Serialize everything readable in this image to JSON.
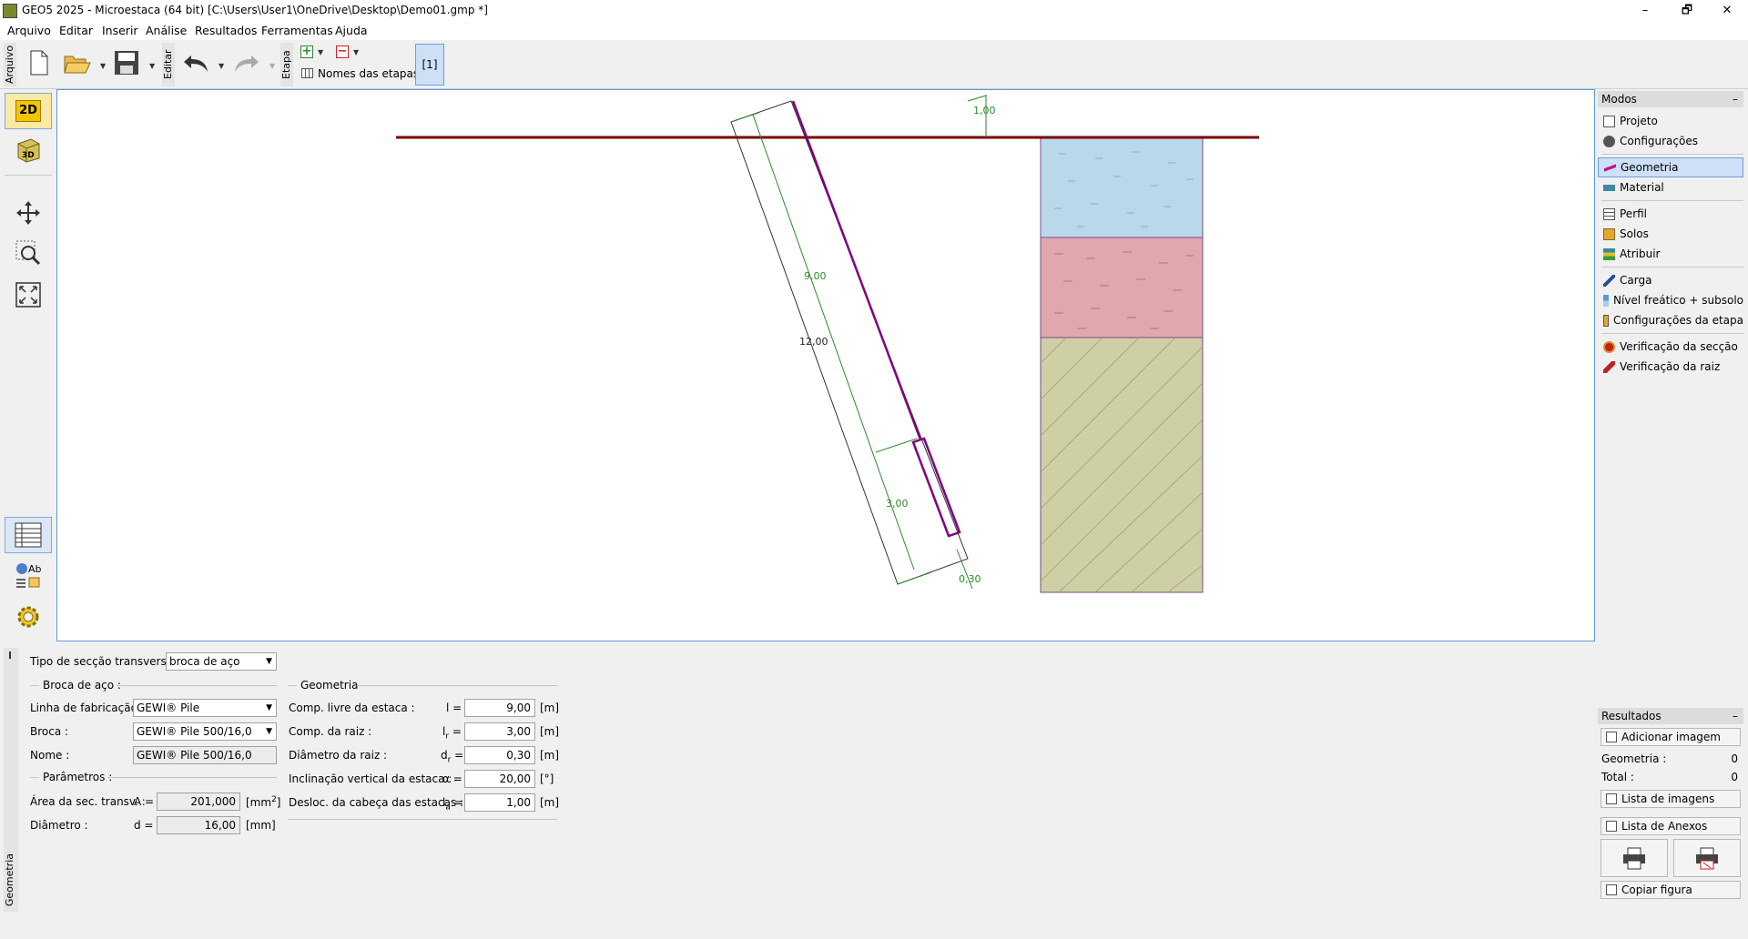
{
  "window": {
    "title": "GEO5 2025 - Microestaca (64 bit) [C:\\Users\\User1\\OneDrive\\Desktop\\Demo01.gmp *]",
    "minimize": "–",
    "maximize": "🗗",
    "close": "✕"
  },
  "menu": [
    "Arquivo",
    "Editar",
    "Inserir",
    "Análise",
    "Resultados",
    "Ferramentas",
    "Ajuda"
  ],
  "toolbar": {
    "tab_file": "Arquivo",
    "tab_edit": "Editar",
    "tab_stage": "Etapa",
    "stage_names": "Nomes das etapas",
    "stage_current": "[1]"
  },
  "leftbar": {
    "btn_2d": "2D",
    "btn_3d": "3D"
  },
  "drawing": {
    "free_length": "9,00",
    "total_length": "12,00",
    "root_length": "3,00",
    "root_diameter": "0,30",
    "head_offset": "1,00",
    "colors": {
      "ground_line": "#7a0000",
      "pile": "#800080",
      "dimension": "#2a8a2a",
      "layer1": "#b9d9ea",
      "layer2": "#e0a8ae",
      "layer3": "#cfcfa6"
    }
  },
  "modes": {
    "title": "Modos",
    "items": [
      {
        "label": "Projeto",
        "icon": "document-icon"
      },
      {
        "label": "Configurações",
        "icon": "gear-icon"
      },
      {
        "label": "Geometria",
        "icon": "geometry-icon"
      },
      {
        "label": "Material",
        "icon": "material-icon"
      },
      {
        "label": "Perfil",
        "icon": "profile-icon"
      },
      {
        "label": "Solos",
        "icon": "soils-icon"
      },
      {
        "label": "Atribuir",
        "icon": "assign-icon"
      },
      {
        "label": "Carga",
        "icon": "load-icon"
      },
      {
        "label": "Nível freático + subsolo",
        "icon": "water-table-icon"
      },
      {
        "label": "Configurações da etapa",
        "icon": "stage-settings-icon"
      },
      {
        "label": "Verificação da secção",
        "icon": "section-check-icon"
      },
      {
        "label": "Verificação da raiz",
        "icon": "root-check-icon"
      }
    ]
  },
  "results": {
    "title": "Resultados",
    "add_image": "Adicionar imagem",
    "geometry_label": "Geometria :",
    "geometry_count": "0",
    "total_label": "Total :",
    "total_count": "0",
    "image_list": "Lista de imagens",
    "attachments_list": "Lista de Anexos",
    "copy_figure": "Copiar figura"
  },
  "form": {
    "tab": "Geometria",
    "section_type_label": "Tipo de secção transversal :",
    "section_type_value": "broca de aço",
    "steel_group": "Broca de aço :",
    "production_line_label": "Linha de fabricação :",
    "production_line_value": "GEWI® Pile",
    "bar_label": "Broca :",
    "bar_value": "GEWI® Pile 500/16,0",
    "name_label": "Nome :",
    "name_value": "GEWI® Pile 500/16,0",
    "params_group": "Parâmetros :",
    "area_label": "Área da sec. transv. :",
    "area_sym": "A =",
    "area_value": "201,000",
    "area_unit": "[mm",
    "area_unit_exp": "2",
    "area_unit_end": "]",
    "diam_label": "Diâmetro :",
    "diam_sym": "d =",
    "diam_value": "16,00",
    "diam_unit": "[mm]",
    "geom_group": "Geometria",
    "free_len_label": "Comp. livre da estaca :",
    "free_len_sym": "l =",
    "free_len_value": "9,00",
    "root_len_label": "Comp. da raiz :",
    "root_len_sym": "l",
    "root_len_sub": "r",
    "root_len_eq": "=",
    "root_len_value": "3,00",
    "root_diam_label": "Diâmetro da raiz :",
    "root_diam_sym": "d",
    "root_diam_sub": "r",
    "root_diam_eq": "=",
    "root_diam_value": "0,30",
    "incl_label": "Inclinação vertical da estaca :",
    "incl_sym": "α =",
    "incl_value": "20,00",
    "incl_unit": "[°]",
    "offset_label": "Desloc. da cabeça das estacas :",
    "offset_sym": "l",
    "offset_sub": "a",
    "offset_eq": "=",
    "offset_value": "1,00",
    "unit_m": "[m]"
  }
}
